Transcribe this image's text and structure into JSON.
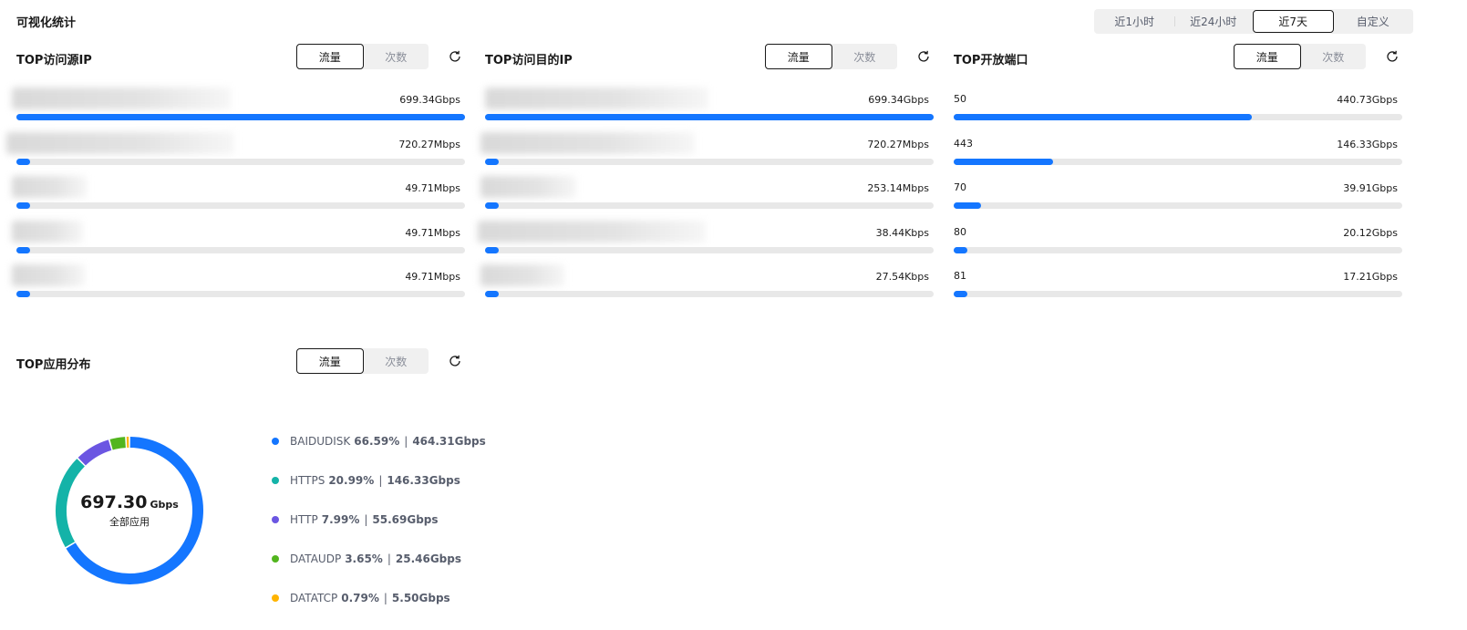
{
  "page": {
    "title": "可视化统计"
  },
  "time_range": {
    "options": [
      "近1小时",
      "近24小时",
      "近7天",
      "自定义"
    ],
    "selected": "近7天"
  },
  "panels": [
    {
      "id": "source-ip",
      "title": "TOP访问源IP",
      "toggle": [
        "流量",
        "次数"
      ],
      "active": "流量",
      "rows": [
        {
          "label": "",
          "value": "699.34Gbps",
          "ratio": 1.0,
          "label_redacted": true
        },
        {
          "label": "",
          "value": "720.27Mbps",
          "ratio": 0.03,
          "label_redacted": true
        },
        {
          "label": "",
          "value": "49.71Mbps",
          "ratio": 0.03,
          "label_redacted": true
        },
        {
          "label": "",
          "value": "49.71Mbps",
          "ratio": 0.03,
          "label_redacted": true
        },
        {
          "label": "",
          "value": "49.71Mbps",
          "ratio": 0.03,
          "label_redacted": true
        }
      ]
    },
    {
      "id": "dest-ip",
      "title": "TOP访问目的IP",
      "toggle": [
        "流量",
        "次数"
      ],
      "active": "流量",
      "rows": [
        {
          "label": "",
          "value": "699.34Gbps",
          "ratio": 1.0,
          "label_redacted": true
        },
        {
          "label": "",
          "value": "720.27Mbps",
          "ratio": 0.03,
          "label_redacted": true
        },
        {
          "label": "",
          "value": "253.14Mbps",
          "ratio": 0.03,
          "label_redacted": true
        },
        {
          "label": "",
          "value": "38.44Kbps",
          "ratio": 0.03,
          "label_redacted": true
        },
        {
          "label": "",
          "value": "27.54Kbps",
          "ratio": 0.03,
          "label_redacted": true
        }
      ]
    },
    {
      "id": "open-port",
      "title": "TOP开放端口",
      "toggle": [
        "流量",
        "次数"
      ],
      "active": "流量",
      "rows": [
        {
          "label": "50",
          "value": "440.73Gbps",
          "ratio": 0.664
        },
        {
          "label": "443",
          "value": "146.33Gbps",
          "ratio": 0.221
        },
        {
          "label": "70",
          "value": "39.91Gbps",
          "ratio": 0.06
        },
        {
          "label": "80",
          "value": "20.12Gbps",
          "ratio": 0.03
        },
        {
          "label": "81",
          "value": "17.21Gbps",
          "ratio": 0.03
        }
      ]
    }
  ],
  "app_panel": {
    "title": "TOP应用分布",
    "toggle": [
      "流量",
      "次数"
    ],
    "active": "流量",
    "total": "697.30",
    "total_unit": "Gbps",
    "total_label": "全部应用",
    "legend": [
      {
        "name": "BAIDUDISK",
        "pct": "66.59%",
        "value": "464.31Gbps",
        "share": 66.59,
        "color": "#1476ff"
      },
      {
        "name": "HTTPS",
        "pct": "20.99%",
        "value": "146.33Gbps",
        "share": 20.99,
        "color": "#14b3a8"
      },
      {
        "name": "HTTP",
        "pct": "7.99%",
        "value": "55.69Gbps",
        "share": 7.99,
        "color": "#6b56e2"
      },
      {
        "name": "DATAUDP",
        "pct": "3.65%",
        "value": "25.46Gbps",
        "share": 3.65,
        "color": "#52b51e"
      },
      {
        "name": "DATATCP",
        "pct": "0.79%",
        "value": "5.50Gbps",
        "share": 0.79,
        "color": "#ffb400"
      }
    ],
    "separator": "|"
  },
  "icons": {
    "refresh": "refresh-icon"
  }
}
